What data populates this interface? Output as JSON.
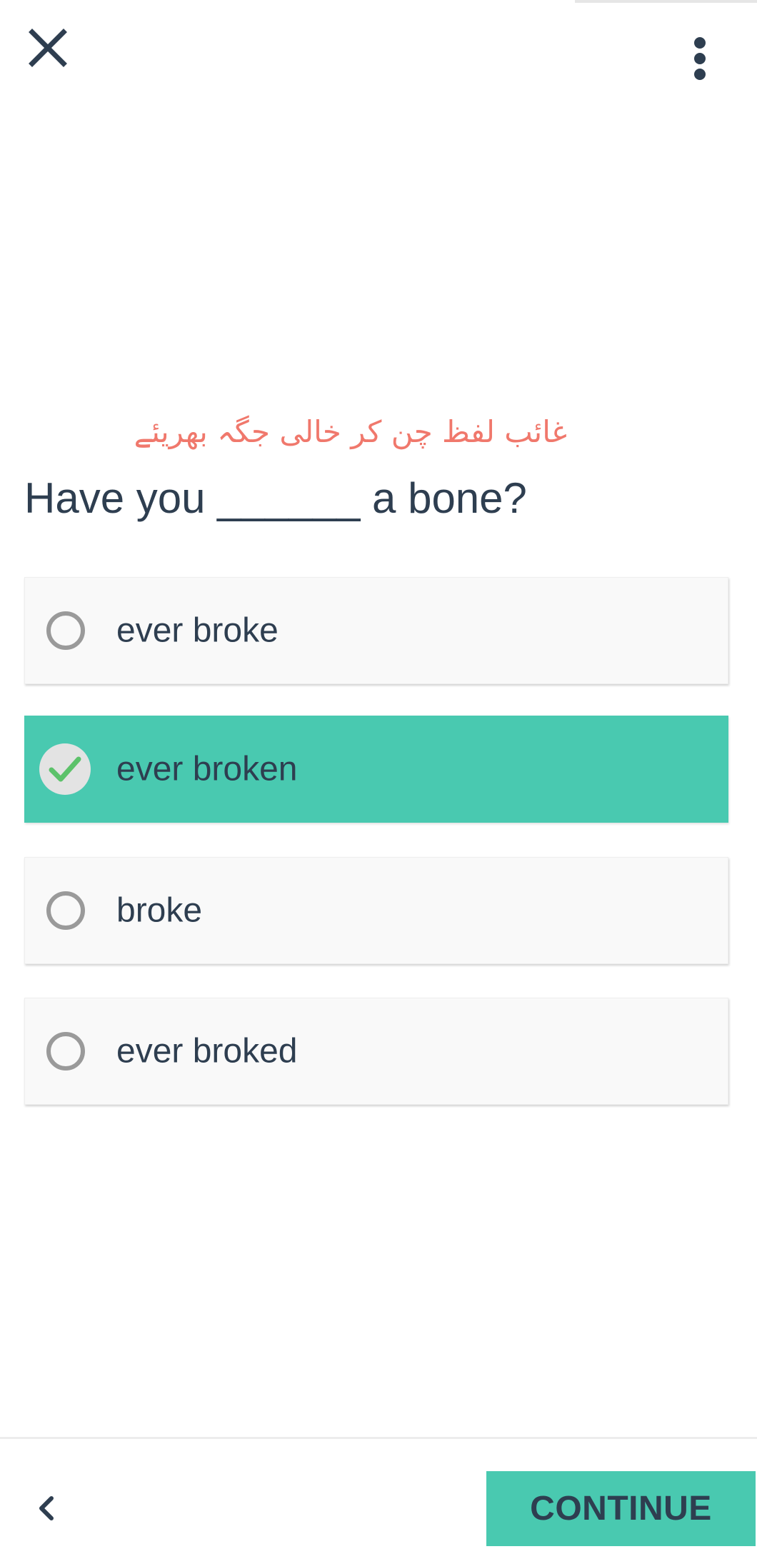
{
  "header": {
    "close_icon": "close-icon",
    "more_icon": "more-vertical-icon"
  },
  "quiz": {
    "instruction": "غائب لفظ چن کر خالی جگہ بھریئے",
    "question": "Have you ______ a bone?",
    "selected_index": 1,
    "options": [
      {
        "label": "ever broke",
        "selected": false
      },
      {
        "label": "ever broken",
        "selected": true
      },
      {
        "label": "broke",
        "selected": false
      },
      {
        "label": "ever broked",
        "selected": false
      }
    ]
  },
  "footer": {
    "back_icon": "chevron-left-icon",
    "continue_label": "CONTINUE"
  },
  "colors": {
    "accent": "#49c9b0",
    "instruction": "#f0786c",
    "text": "#2e3e50",
    "check": "#5cc26a"
  }
}
